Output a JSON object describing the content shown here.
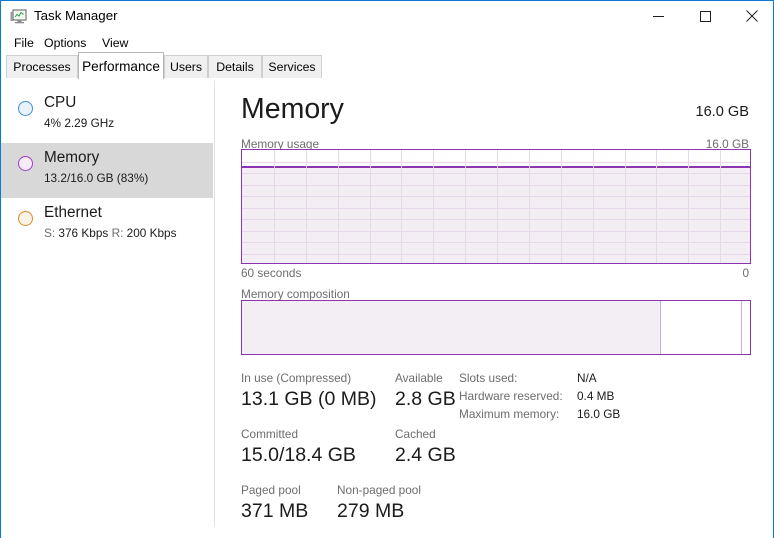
{
  "window": {
    "title": "Task Manager",
    "icon": "task-manager-icon",
    "controls": {
      "minimize": "—",
      "maximize": "□",
      "close": "✕"
    }
  },
  "menu": {
    "items": [
      {
        "label": "File"
      },
      {
        "label": "Options"
      },
      {
        "label": "View"
      }
    ]
  },
  "tabs": [
    {
      "label": "Processes",
      "active": false
    },
    {
      "label": "Performance",
      "active": true
    },
    {
      "label": "Users",
      "active": false
    },
    {
      "label": "Details",
      "active": false
    },
    {
      "label": "Services",
      "active": false
    }
  ],
  "sidebar": {
    "items": [
      {
        "name": "CPU",
        "title": "CPU",
        "subtitle": "4% 2.29 GHz",
        "color": "#3f8fd2",
        "fill": "#e8f2fa",
        "selected": false
      },
      {
        "name": "Memory",
        "title": "Memory",
        "subtitle": "13.2/16.0 GB (83%)",
        "color": "#a03cc4",
        "fill": "#f6ecf9",
        "selected": true
      },
      {
        "name": "Ethernet",
        "title": "Ethernet",
        "subtitle_parts": [
          {
            "text": "S:",
            "dim": true
          },
          {
            "text": " 376 Kbps ",
            "dim": false
          },
          {
            "text": "R:",
            "dim": true
          },
          {
            "text": " 200 Kbps",
            "dim": false
          }
        ],
        "subtitle": "S: 376 Kbps R: 200 Kbps",
        "color": "#d98b2b",
        "fill": "#fbf1e4",
        "selected": false
      }
    ]
  },
  "main": {
    "title": "Memory",
    "total": "16.0 GB",
    "accent": "#8b35b0",
    "fill_color": "#f3eef4",
    "usage_graph": {
      "label": "Memory usage",
      "max_label": "16.0 GB",
      "time_label": "60 seconds",
      "zero_label": "0",
      "usage_percent": 83,
      "grid_columns": 16,
      "grid_rows": 10
    },
    "composition": {
      "label": "Memory composition",
      "in_use_percent": 82.2,
      "standby_divider_percent": 98.2
    },
    "stats": {
      "left_column": [
        {
          "label": "In use (Compressed)",
          "value": "13.1 GB (0 MB)"
        },
        {
          "label": "Committed",
          "value": "15.0/18.4 GB"
        },
        {
          "label": "Paged pool",
          "value": "371 MB"
        }
      ],
      "middle_column": [
        {
          "label": "Available",
          "value": "2.8 GB"
        },
        {
          "label": "Cached",
          "value": "2.4 GB"
        },
        {
          "label": "Non-paged pool",
          "value": "279 MB"
        }
      ],
      "right_column": [
        {
          "label": "Slots used:",
          "value": "N/A"
        },
        {
          "label": "Hardware reserved:",
          "value": "0.4 MB"
        },
        {
          "label": "Maximum memory:",
          "value": "16.0 GB"
        }
      ]
    }
  }
}
